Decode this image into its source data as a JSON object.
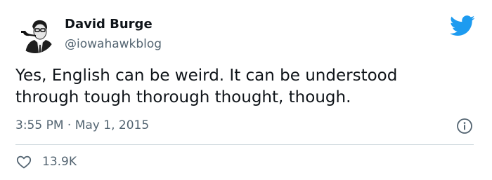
{
  "author": {
    "name": "David Burge",
    "handle": "@iowahawkblog"
  },
  "tweet": {
    "text": "Yes, English can be weird. It can be understood through tough thorough thought, though."
  },
  "meta": {
    "time": "3:55 PM",
    "separator": " · ",
    "date": "May 1, 2015"
  },
  "actions": {
    "like_count": "13.9K"
  },
  "icons": {
    "brand": "twitter-bird-icon",
    "info": "info-icon",
    "like": "heart-icon"
  },
  "colors": {
    "brand_blue": "#1d9bf0",
    "text_primary": "#0f1419",
    "text_secondary": "#536471",
    "divider": "#cfd9de"
  }
}
